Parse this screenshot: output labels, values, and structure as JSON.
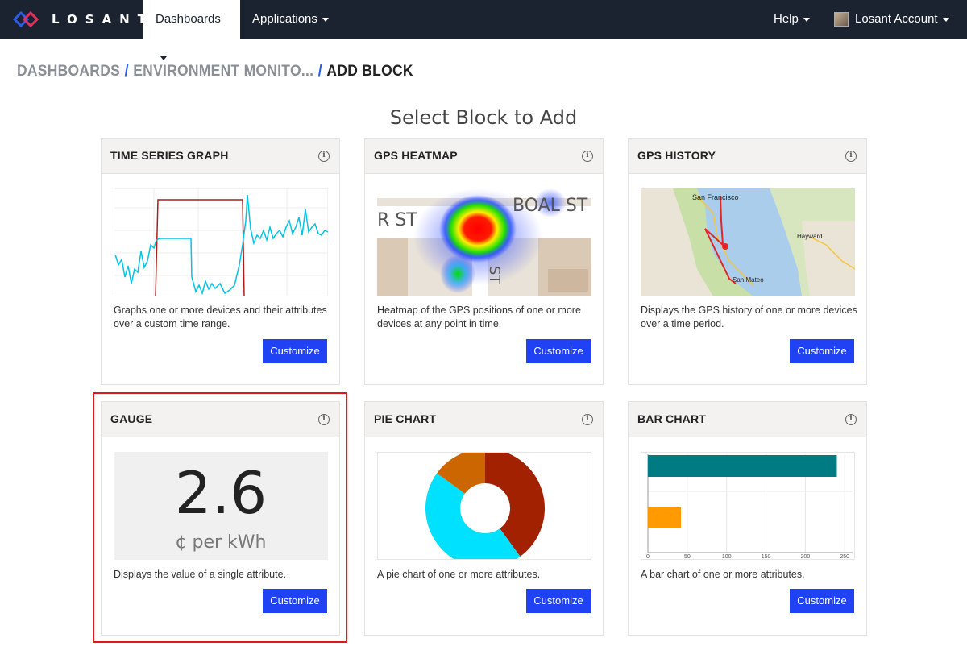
{
  "nav": {
    "brand": "LOSANT",
    "dashboards": "Dashboards",
    "applications": "Applications",
    "help": "Help",
    "account": "Losant Account"
  },
  "breadcrumb": {
    "dashboards": "DASHBOARDS",
    "sep": "/",
    "dashboard": "ENVIRONMENT MONITO...",
    "current": "ADD BLOCK"
  },
  "page_title": "Select Block to Add",
  "blocks": [
    {
      "title": "TIME SERIES GRAPH",
      "description": "Graphs one or more devices and their attributes over a custom time range.",
      "button": "Customize"
    },
    {
      "title": "GPS HEATMAP",
      "description": "Heatmap of the GPS positions of one or more devices at any point in time.",
      "button": "Customize",
      "map_labels": [
        "R ST",
        "BOAL ST",
        "ST"
      ]
    },
    {
      "title": "GPS HISTORY",
      "description": "Displays the GPS history of one or more devices over a time period.",
      "button": "Customize",
      "map_labels": [
        "San Francisco",
        "Hayward",
        "San Mateo"
      ]
    },
    {
      "title": "GAUGE",
      "description": "Displays the value of a single attribute.",
      "button": "Customize",
      "value": "2.6",
      "unit": "¢ per kWh"
    },
    {
      "title": "PIE CHART",
      "description": "A pie chart of one or more attributes.",
      "button": "Customize"
    },
    {
      "title": "BAR CHART",
      "description": "A bar chart of one or more attributes.",
      "button": "Customize"
    }
  ],
  "info_icon": "info-icon",
  "colors": {
    "navbar": "#1b2230",
    "button": "#2042f5",
    "highlight": "#e01818",
    "pie": [
      "#a12100",
      "#00e1ff",
      "#cc6600"
    ],
    "bars": [
      "#007b83",
      "#ff9b00"
    ]
  },
  "chart_data": [
    {
      "type": "pie",
      "title": "",
      "values": [
        40,
        45,
        15
      ],
      "colors": [
        "#a12100",
        "#00e1ff",
        "#cc6600"
      ],
      "donut": true
    },
    {
      "type": "bar",
      "title": "",
      "orientation": "horizontal",
      "values": [
        240,
        42
      ],
      "colors": [
        "#007b83",
        "#ff9b00"
      ],
      "xlim": [
        0,
        260
      ],
      "xticks": [
        "0",
        "50",
        "100",
        "150",
        "200",
        "250"
      ],
      "grid": true
    }
  ]
}
